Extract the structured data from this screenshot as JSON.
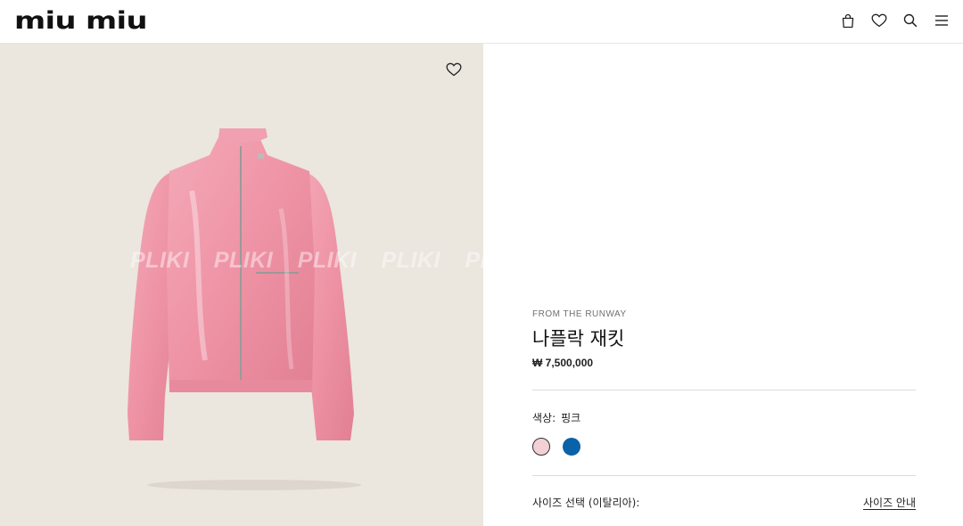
{
  "header": {
    "logo": "miu miu",
    "icons": [
      "bag-icon",
      "heart-icon",
      "search-icon",
      "menu-icon"
    ]
  },
  "gallery": {
    "watermark": [
      "PLIKI",
      "PLIKI",
      "PLIKI",
      "PLIKI",
      "PLIKI"
    ],
    "wishlist_icon": "heart-icon"
  },
  "product": {
    "eyebrow": "FROM THE RUNWAY",
    "name": "나플락 재킷",
    "price": "₩ 7,500,000",
    "color_label": "색상:",
    "color_value": "핑크",
    "swatches": [
      {
        "name": "pink",
        "color": "#f3cfd6",
        "selected": true
      },
      {
        "name": "blue",
        "color": "#0a62a8",
        "selected": false
      }
    ],
    "size_label": "사이즈 선택 (이탈리아):",
    "size_guide": "사이즈 안내"
  },
  "colors": {
    "image_bg": "#ebe6de",
    "jacket_pink": "#ef97a8",
    "divider": "#dcdcdc"
  }
}
